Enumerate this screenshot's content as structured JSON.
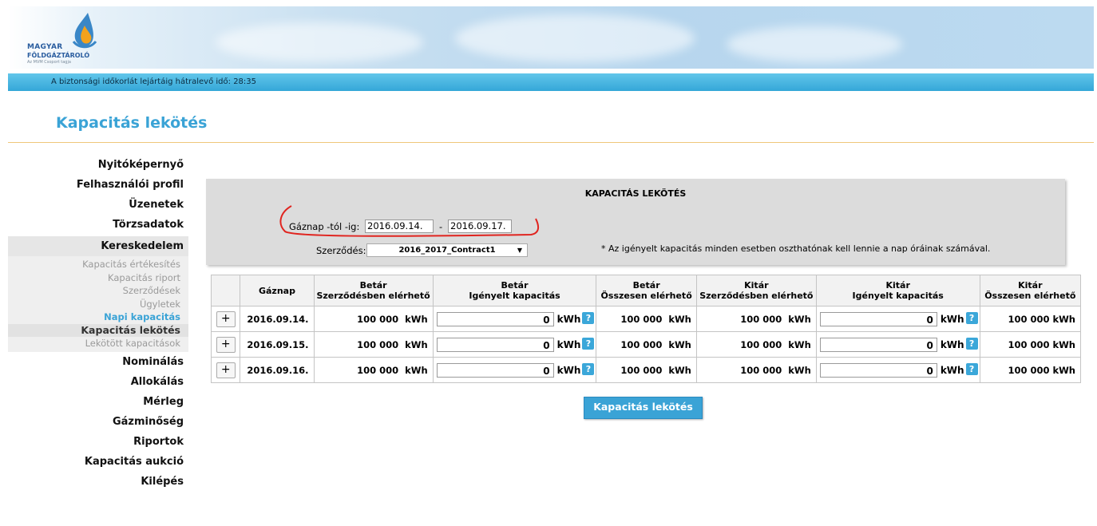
{
  "brand": {
    "line1": "MAGYAR",
    "line2": "FÖLDGÁZTÁROLÓ",
    "line3": "Az MVM Csoport tagja"
  },
  "session_bar": {
    "text": "A biztonsági időkorlát lejártáig hátralevő idő: 28:35"
  },
  "page_title": "Kapacitás lekötés",
  "sidebar": {
    "top_items": [
      "Nyitóképernyő",
      "Felhasználói profil",
      "Üzenetek",
      "Törzsadatok"
    ],
    "section": "Kereskedelem",
    "sub_items": [
      "Kapacitás értékesítés",
      "Kapacitás riport",
      "Szerződések",
      "Ügyletek"
    ],
    "active_sub": "Napi kapacitás",
    "current_sub": "Kapacitás lekötés",
    "after_sub": "Lekötött kapacitások",
    "bottom_items": [
      "Nominálás",
      "Allokálás",
      "Mérleg",
      "Gázminőség",
      "Riportok",
      "Kapacitás aukció",
      "Kilépés"
    ]
  },
  "panel": {
    "title": "KAPACITÁS LEKÖTÉS",
    "date_label": "Gáznap -tól -ig:",
    "date_from": "2016.09.14.",
    "date_sep": "-",
    "date_to": "2016.09.17.",
    "contract_label": "Szerződés:",
    "contract_value": "2016_2017_Contract1",
    "note": "* Az igényelt kapacitás minden esetben oszthatónak kell lennie a nap óráinak számával."
  },
  "table": {
    "headers": [
      {
        "l1": "",
        "l2": ""
      },
      {
        "l1": "Gáznap",
        "l2": ""
      },
      {
        "l1": "Betár",
        "l2": "Szerződésben elérhető"
      },
      {
        "l1": "Betár",
        "l2": "Igényelt kapacitás"
      },
      {
        "l1": "Betár",
        "l2": "Összesen elérhető"
      },
      {
        "l1": "Kitár",
        "l2": "Szerződésben elérhető"
      },
      {
        "l1": "Kitár",
        "l2": "Igényelt kapacitás"
      },
      {
        "l1": "Kitár",
        "l2": "Összesen elérhető"
      }
    ],
    "unit": "kWh",
    "help": "?",
    "plus": "+",
    "rows": [
      {
        "date": "2016.09.14.",
        "betar_szerz": "100 000",
        "betar_ig": "0",
        "betar_ossz": "100 000",
        "kitar_szerz": "100 000",
        "kitar_ig": "0",
        "kitar_ossz": "100 000"
      },
      {
        "date": "2016.09.15.",
        "betar_szerz": "100 000",
        "betar_ig": "0",
        "betar_ossz": "100 000",
        "kitar_szerz": "100 000",
        "kitar_ig": "0",
        "kitar_ossz": "100 000"
      },
      {
        "date": "2016.09.16.",
        "betar_szerz": "100 000",
        "betar_ig": "0",
        "betar_ossz": "100 000",
        "kitar_szerz": "100 000",
        "kitar_ig": "0",
        "kitar_ossz": "100 000"
      }
    ]
  },
  "submit_label": "Kapacitás lekötés",
  "colors": {
    "accent": "#3aa3d6",
    "bar": "#34a7d8",
    "annotation": "#e0241f"
  }
}
